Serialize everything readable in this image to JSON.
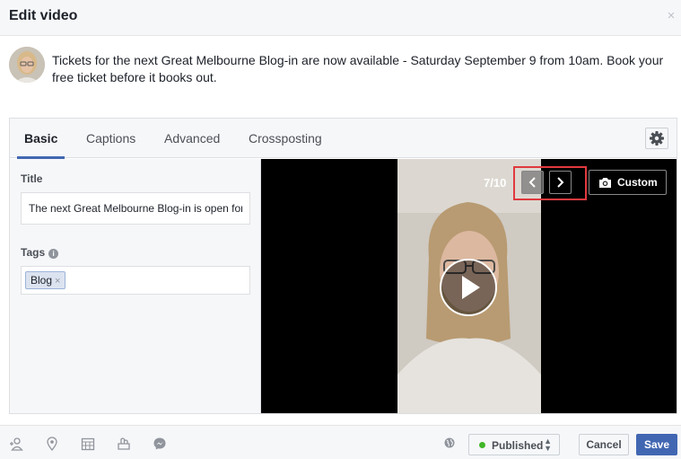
{
  "dialog": {
    "title": "Edit video",
    "close_symbol": "×"
  },
  "post": {
    "avatar_icon": "user-avatar",
    "text": "Tickets for the next Great Melbourne Blog-in are now available - Saturday September 9 from 10am. Book your free ticket before it books out."
  },
  "tabs": [
    {
      "label": "Basic",
      "active": true
    },
    {
      "label": "Captions",
      "active": false
    },
    {
      "label": "Advanced",
      "active": false
    },
    {
      "label": "Crossposting",
      "active": false
    }
  ],
  "settings_icon": "gear-icon",
  "form": {
    "title_label": "Title",
    "title_value": "The next Great Melbourne Blog-in is open for bookings",
    "tags_label": "Tags",
    "tags_info_symbol": "i",
    "tags": [
      "Blog"
    ],
    "tag_remove_symbol": "×"
  },
  "thumbnail": {
    "counter": "7/10",
    "current": 7,
    "total": 10,
    "custom_label": "Custom",
    "highlight_color": "#e0393e"
  },
  "footer": {
    "icons": [
      "tag-people-icon",
      "location-icon",
      "schedule-icon",
      "feeling-icon",
      "messenger-icon"
    ],
    "privacy_icon": "globe-icon",
    "status_label": "Published",
    "status_color": "#42b72a",
    "status_caret": "▲▼",
    "cancel_label": "Cancel",
    "save_label": "Save",
    "save_color": "#4267b2"
  }
}
